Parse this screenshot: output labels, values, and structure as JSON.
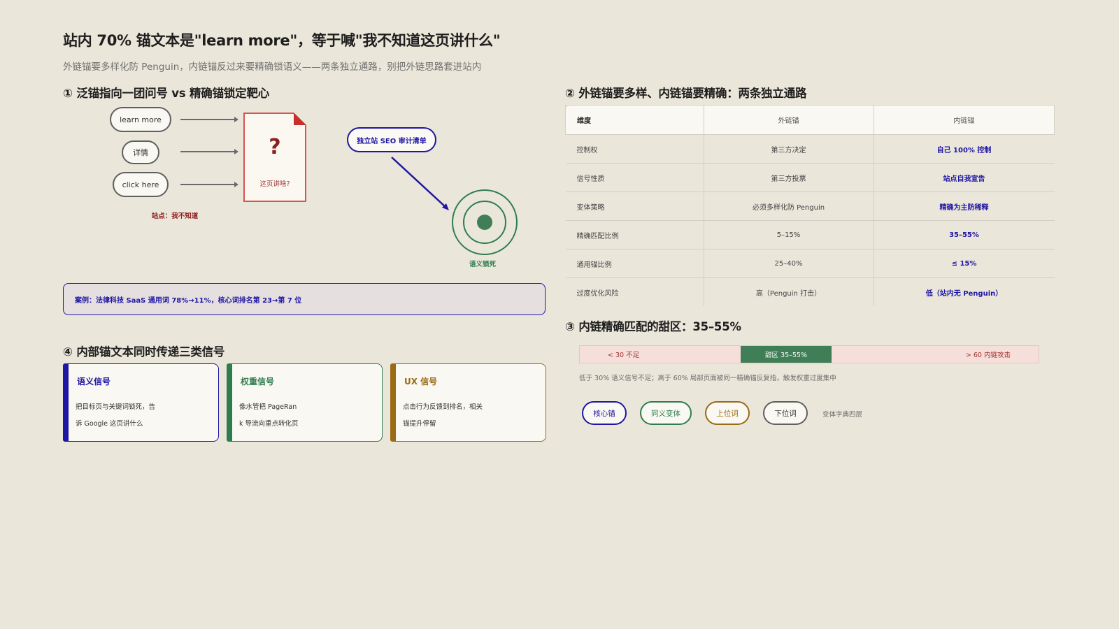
{
  "header": {
    "title": "站内 70% 锚文本是\"learn more\"，等于喊\"我不知道这页讲什么\"",
    "subtitle": "外链锚要多样化防 Penguin，内链锚反过来要精确锁语义——两条独立通路，别把外链思路套进站内"
  },
  "panel1": {
    "heading": "① 泛锚指向一团问号 vs 精确锚锁定靶心",
    "pills": [
      "learn more",
      "详情",
      "click here"
    ],
    "doc_mark": "?",
    "doc_label": "这页讲啥?",
    "red_caption": "站点：我不知道",
    "precise_anchor": "独立站 SEO 审计清单",
    "target_caption": "语义锁死",
    "case": "案例：法律科技 SaaS 通用词 78%→11%，核心词排名第 23→第 7 位",
    "colors": {
      "generic": "#6a6a6a",
      "doc": "#d9534f",
      "precise": "#1f17a3",
      "target": "#2e7d4f"
    }
  },
  "panel2": {
    "heading": "② 外链锚要多样、内链锚要精确：两条独立通路",
    "columns": [
      "维度",
      "外链锚",
      "内链锚"
    ],
    "rows": [
      [
        "控制权",
        "第三方决定",
        "自己 100% 控制"
      ],
      [
        "信号性质",
        "第三方投票",
        "站点自我宣告"
      ],
      [
        "变体策略",
        "必须多样化防 Penguin",
        "精确为主防稀释"
      ],
      [
        "精确匹配比例",
        "5–15%",
        "35–55%"
      ],
      [
        "通用锚比例",
        "25–40%",
        "≤ 15%"
      ],
      [
        "过度优化风险",
        "高（Penguin 打击）",
        "低（站内无 Penguin）"
      ]
    ]
  },
  "panel3": {
    "heading": "③ 内链精确匹配的甜区：35–55%",
    "low_label": "< 30 不足",
    "mid_label": "甜区 35–55%",
    "high_label": "> 60 内链攻击",
    "note": "低于 30% 语义信号不足；高于 60% 局部页面被同一精确锚反复指，触发权重过度集中",
    "chips": [
      {
        "label": "核心锚",
        "color": "#1f17a3"
      },
      {
        "label": "同义变体",
        "color": "#2e7d4f"
      },
      {
        "label": "上位词",
        "color": "#9a6a14"
      },
      {
        "label": "下位词",
        "color": "#5f5f5f"
      }
    ],
    "chip_note": "变体字典四层"
  },
  "panel4": {
    "heading": "④ 内部锚文本同时传递三类信号",
    "cards": [
      {
        "title": "语义信号",
        "line1": "把目标页与关键词锁死，告",
        "line2": "诉 Google 这页讲什么",
        "color": "#1f17a3"
      },
      {
        "title": "权重信号",
        "line1": "像水管把 PageRan",
        "line2": "k 导流向重点转化页",
        "color": "#2e7d4f"
      },
      {
        "title": "UX 信号",
        "line1": "点击行为反馈到排名，相关",
        "line2": "锚提升停留",
        "color": "#9a6a14"
      }
    ]
  }
}
